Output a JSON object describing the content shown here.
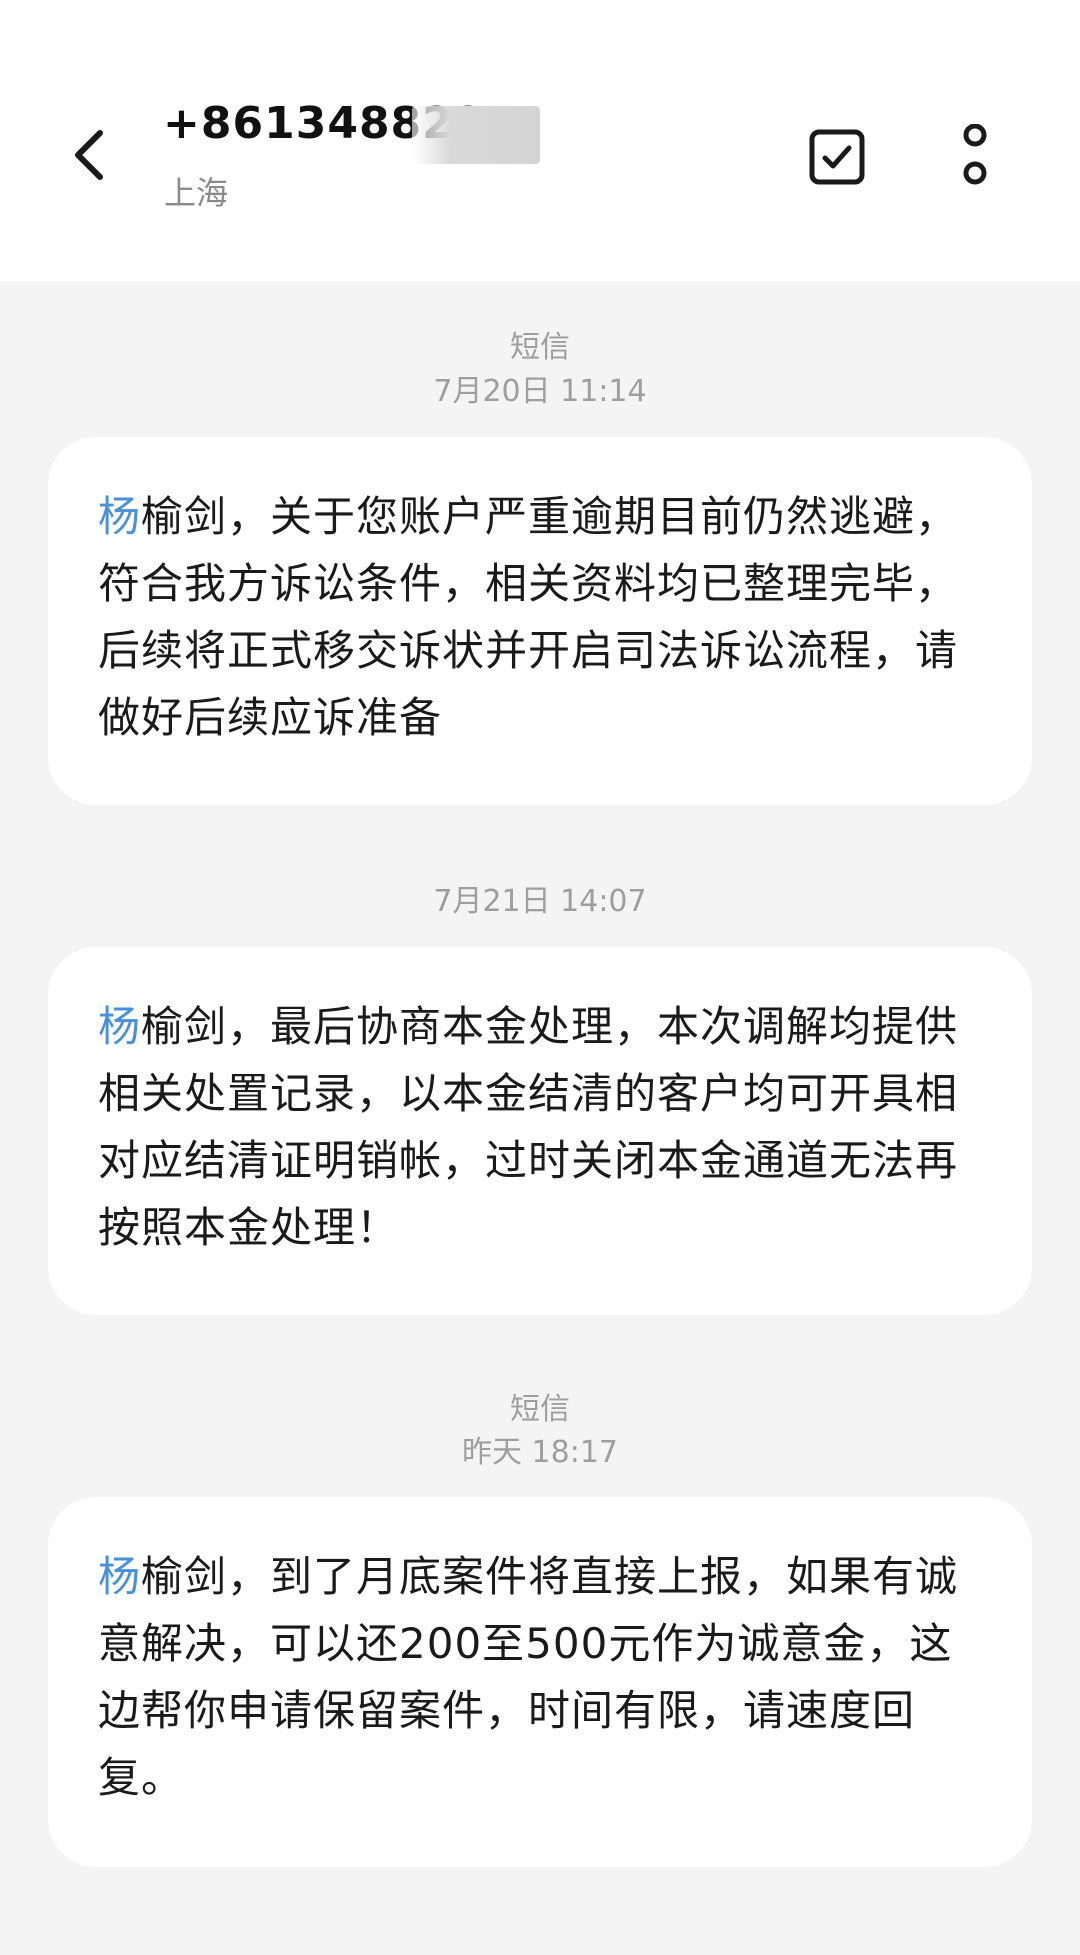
{
  "header": {
    "contact_number": "+861348822",
    "location": "上海",
    "back_icon": "chevron-left-icon",
    "select_icon": "checkbox-check-icon",
    "more_icon": "more-vertical-icon"
  },
  "conversation": {
    "groups": [
      {
        "label": "短信",
        "time": "7月20日 11:14"
      },
      {
        "label": "",
        "time": "7月21日 14:07"
      },
      {
        "label": "短信",
        "time": "昨天 18:17"
      }
    ],
    "messages": [
      {
        "name": "杨",
        "body": "榆剑，关于您账户严重逾期目前仍然逃避，符合我方诉讼条件，相关资料均已整理完毕，后续将正式移交诉状并开启司法诉讼流程，请做好后续应诉准备"
      },
      {
        "name": "杨",
        "body": "榆剑，最后协商本金处理，本次调解均提供相关处置记录，以本金结清的客户均可开具相对应结清证明销帐，过时关闭本金通道无法再按照本金处理！"
      },
      {
        "name": "杨",
        "body": "榆剑，到了月底案件将直接上报，如果有诚意解决，可以还200至500元作为诚意金，这边帮你申请保留案件，时间有限，请速度回复。"
      }
    ]
  },
  "colors": {
    "name_link": "#4a90d9",
    "background": "#f4f4f4",
    "bubble": "#ffffff",
    "meta_text": "#9e9e9e"
  }
}
